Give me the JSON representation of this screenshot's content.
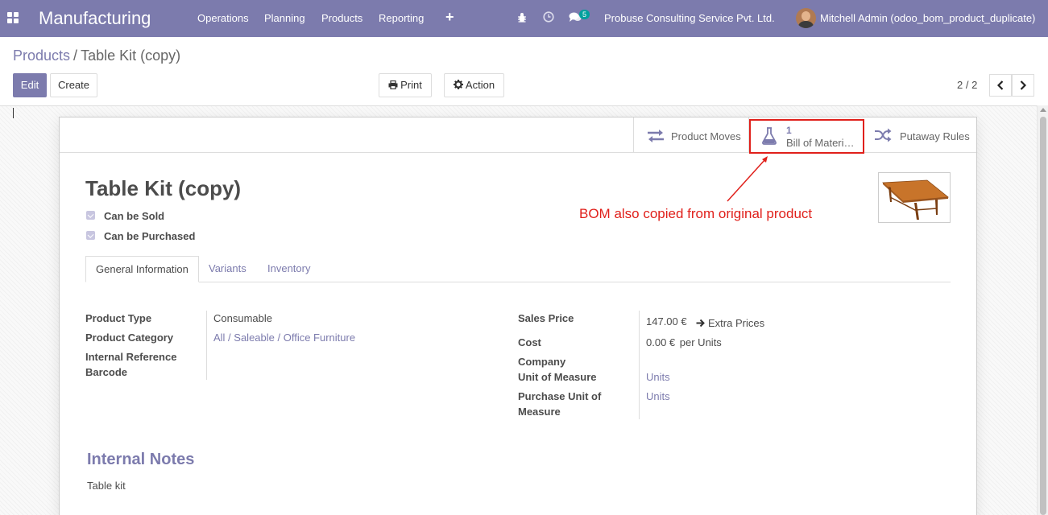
{
  "navbar": {
    "app_name": "Manufacturing",
    "menus": [
      "Operations",
      "Planning",
      "Products",
      "Reporting"
    ],
    "chat_count": "5",
    "company": "Probuse Consulting Service Pvt. Ltd.",
    "user": "Mitchell Admin (odoo_bom_product_duplicate)",
    "icons": [
      "apps-icon",
      "plus-icon",
      "bug-icon",
      "clock-icon",
      "chat-icon"
    ]
  },
  "breadcrumb": {
    "parent": "Products",
    "separator": "/",
    "current": "Table Kit (copy)"
  },
  "toolbar": {
    "edit": "Edit",
    "create": "Create",
    "print": "Print",
    "action": "Action"
  },
  "pager": {
    "value": "2 / 2"
  },
  "smart_buttons": {
    "product_moves": "Product Moves",
    "bom_count": "1",
    "bom_label": "Bill of Materi…",
    "putaway": "Putaway Rules"
  },
  "product": {
    "name": "Table Kit (copy)",
    "can_be_sold": "Can be Sold",
    "can_be_purchased": "Can be Purchased"
  },
  "annotation": "BOM also copied from original product",
  "tabs": [
    "General Information",
    "Variants",
    "Inventory"
  ],
  "general": {
    "left": {
      "product_type_label": "Product Type",
      "product_type": "Consumable",
      "category_label": "Product Category",
      "category": "All / Saleable / Office Furniture",
      "internal_ref_label": "Internal Reference",
      "barcode_label": "Barcode"
    },
    "right": {
      "sales_price_label": "Sales Price",
      "sales_price": "147.00 €",
      "extra_prices": "Extra Prices",
      "cost_label": "Cost",
      "cost": "0.00 €",
      "cost_unit": "per Units",
      "company_label": "Company",
      "uom_label": "Unit of Measure",
      "uom": "Units",
      "purchase_uom_label_1": "Purchase Unit of",
      "purchase_uom_label_2": "Measure",
      "purchase_uom": "Units"
    }
  },
  "internal_notes": {
    "title": "Internal Notes",
    "text": "Table kit"
  },
  "colors": {
    "brand": "#7c7bad",
    "annotation": "#e0201b"
  }
}
